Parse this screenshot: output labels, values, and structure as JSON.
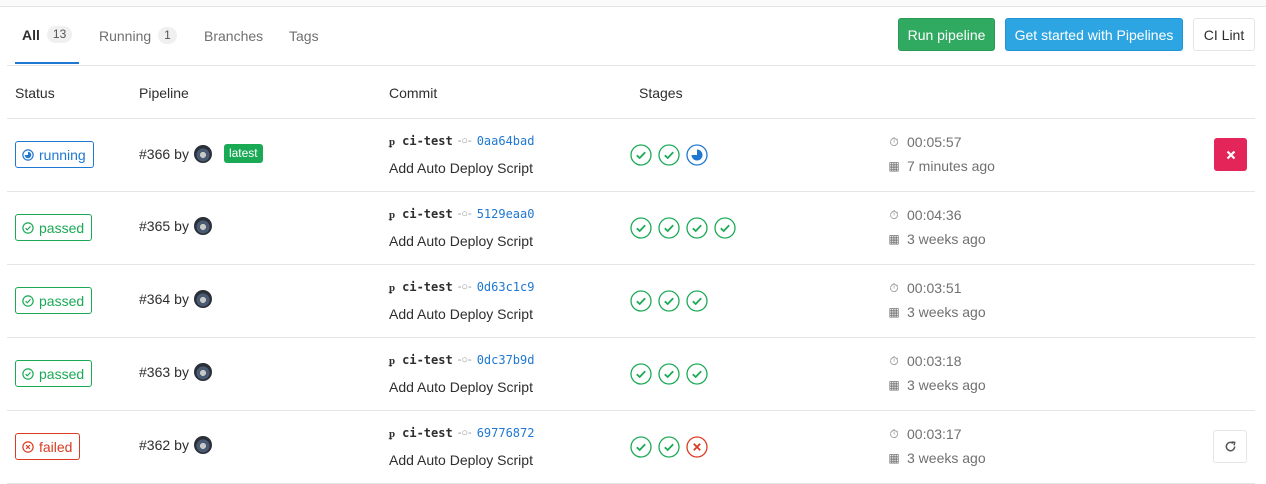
{
  "tabs": [
    {
      "label": "All",
      "count": "13"
    },
    {
      "label": "Running",
      "count": "1"
    },
    {
      "label": "Branches"
    },
    {
      "label": "Tags"
    }
  ],
  "buttons": {
    "run_pipeline": "Run pipeline",
    "get_started": "Get started with Pipelines",
    "ci_lint": "CI Lint"
  },
  "table": {
    "headers": {
      "status": "Status",
      "pipeline": "Pipeline",
      "commit": "Commit",
      "stages": "Stages"
    },
    "by_label": "by",
    "latest_badge": "latest",
    "rows": [
      {
        "status": "running",
        "id": "#366",
        "branch": "ci-test",
        "sha": "0aa64bad",
        "title": "Add Auto Deploy Script",
        "duration": "00:05:57",
        "finished": "7 minutes ago",
        "stages": [
          "passed",
          "passed",
          "running"
        ],
        "action": "cancel"
      },
      {
        "status": "passed",
        "id": "#365",
        "branch": "ci-test",
        "sha": "5129eaa0",
        "title": "Add Auto Deploy Script",
        "duration": "00:04:36",
        "finished": "3 weeks ago",
        "stages": [
          "passed",
          "passed",
          "passed",
          "passed"
        ],
        "action": ""
      },
      {
        "status": "passed",
        "id": "#364",
        "branch": "ci-test",
        "sha": "0d63c1c9",
        "title": "Add Auto Deploy Script",
        "duration": "00:03:51",
        "finished": "3 weeks ago",
        "stages": [
          "passed",
          "passed",
          "passed"
        ],
        "action": ""
      },
      {
        "status": "passed",
        "id": "#363",
        "branch": "ci-test",
        "sha": "0dc37b9d",
        "title": "Add Auto Deploy Script",
        "duration": "00:03:18",
        "finished": "3 weeks ago",
        "stages": [
          "passed",
          "passed",
          "passed"
        ],
        "action": ""
      },
      {
        "status": "failed",
        "id": "#362",
        "branch": "ci-test",
        "sha": "69776872",
        "title": "Add Auto Deploy Script",
        "duration": "00:03:17",
        "finished": "3 weeks ago",
        "stages": [
          "passed",
          "passed",
          "failed"
        ],
        "action": "retry"
      }
    ]
  },
  "colors": {
    "accent": "#1f78d1",
    "success": "#1aaa55",
    "danger": "#db3b21",
    "cancel": "#e4255a"
  },
  "icons": {
    "duration": "timer-icon",
    "finished": "calendar-icon",
    "branch": "branch-icon",
    "commit": "commit-icon"
  }
}
